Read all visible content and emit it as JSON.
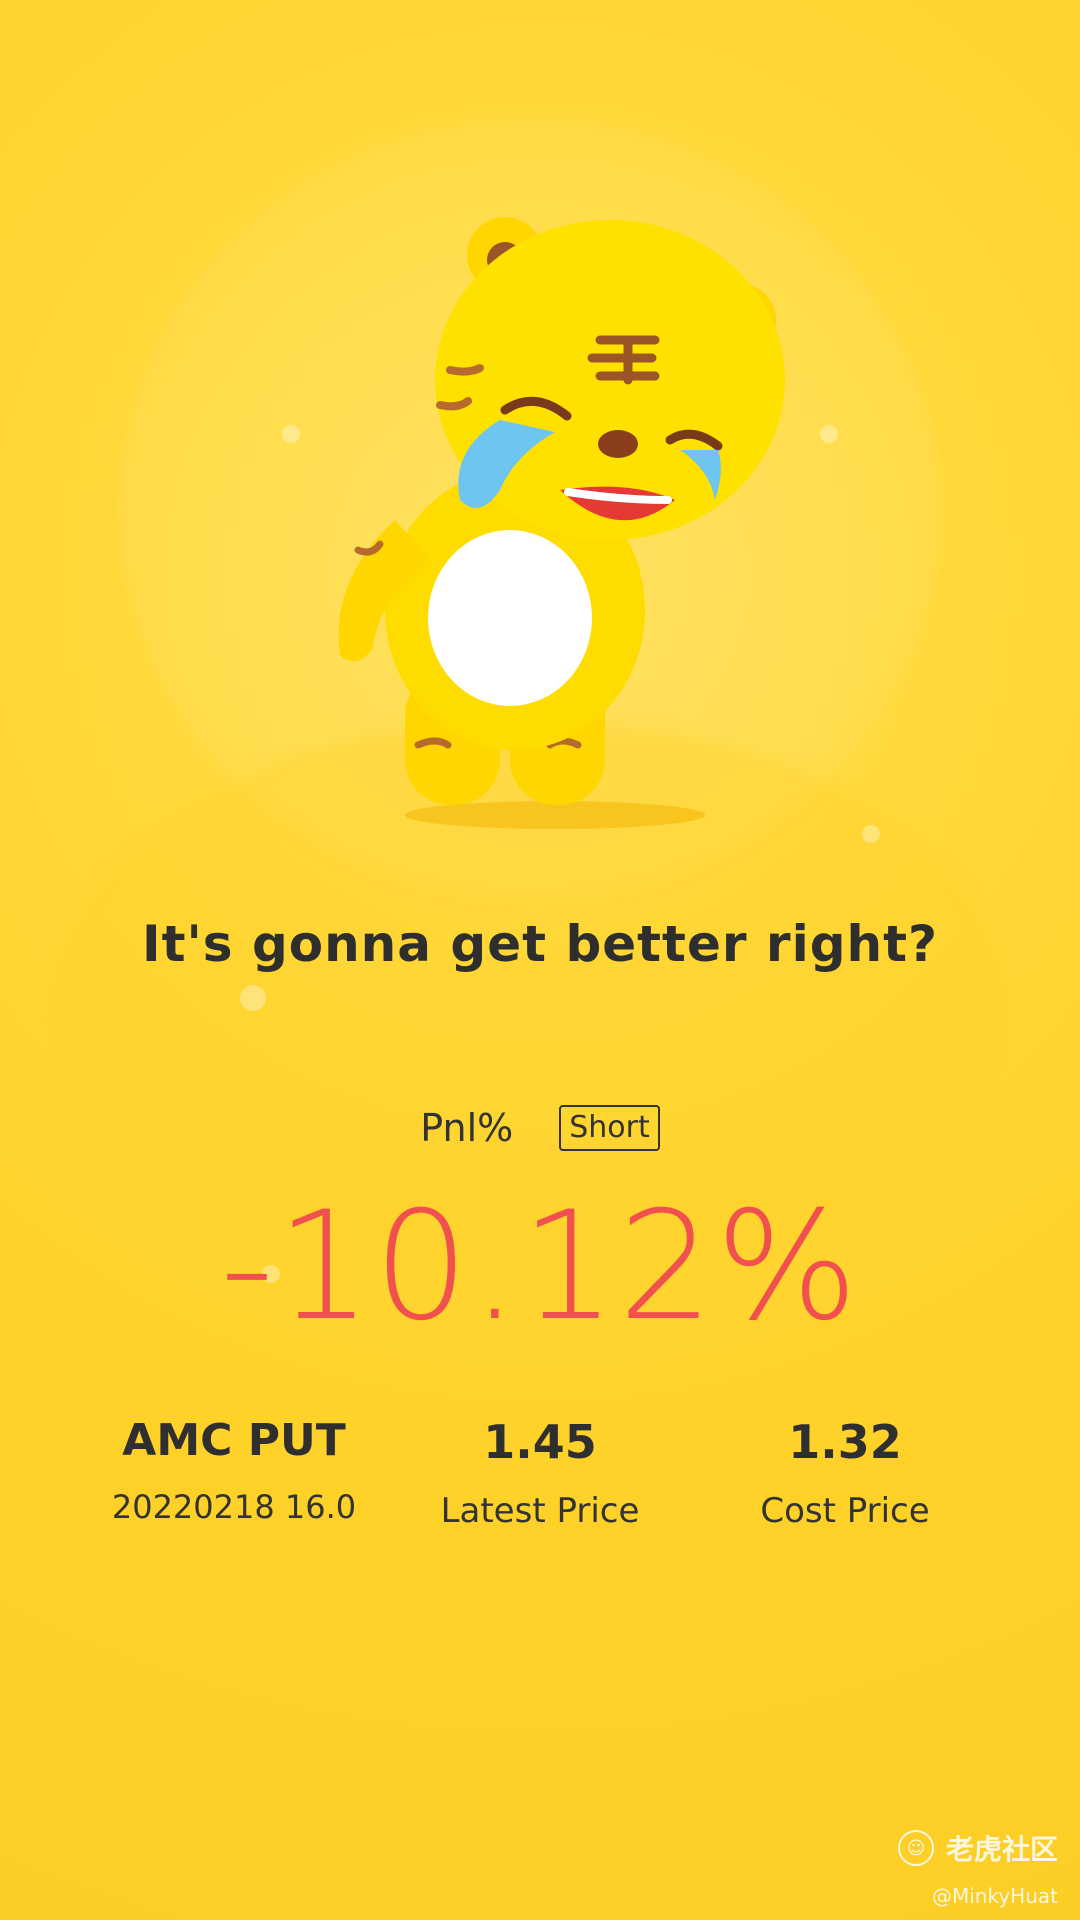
{
  "headline": "It's gonna get better right?",
  "pnl": {
    "label": "Pnl%",
    "direction_badge": "Short",
    "value": "-10.12%"
  },
  "stats": [
    {
      "main": "AMC PUT",
      "sub": "20220218 16.0"
    },
    {
      "main": "1.45",
      "sub": "Latest Price"
    },
    {
      "main": "1.32",
      "sub": "Cost Price"
    }
  ],
  "watermark": {
    "brand": "老虎社区",
    "handle": "@MinkyHuat"
  },
  "colors": {
    "background": "#ffd22a",
    "loss": "#f0514e",
    "text": "#2f2f2f"
  }
}
